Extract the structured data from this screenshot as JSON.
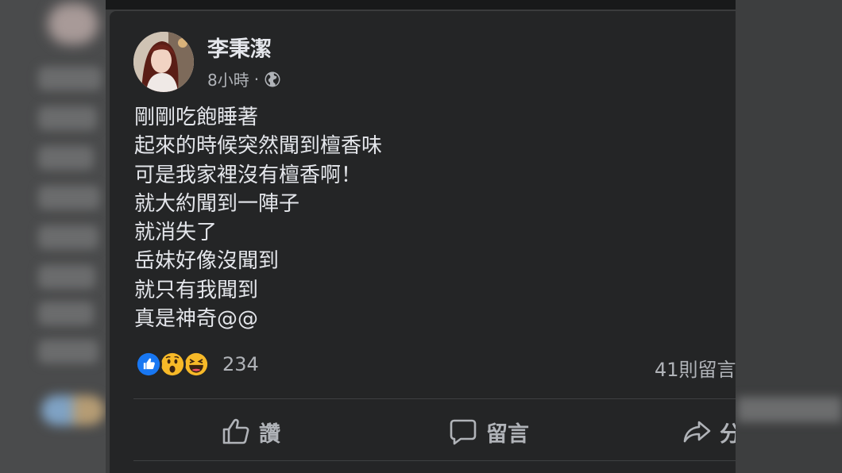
{
  "post": {
    "author": "李秉潔",
    "time": "8小時",
    "separator": "·",
    "privacy_icon": "globe-icon",
    "lines": [
      "剛剛吃飽睡著",
      "起來的時候突然聞到檀香味",
      "可是我家裡沒有檀香啊！",
      "就大約聞到一陣子",
      "就消失了",
      "岳妹好像沒聞到",
      "就只有我聞到",
      "真是神奇@@"
    ],
    "reactions": {
      "icons": [
        "like-icon",
        "wow-icon",
        "haha-icon"
      ],
      "count": "234"
    },
    "comment_count": "41則留言",
    "actions": {
      "like": "讚",
      "comment": "留言",
      "share": "分享"
    }
  },
  "colors": {
    "card_bg": "#242526",
    "text_primary": "#e4e6eb",
    "text_secondary": "#b0b3b8",
    "like_blue": "#1877f2",
    "emoji_yellow": "#f7b928"
  }
}
